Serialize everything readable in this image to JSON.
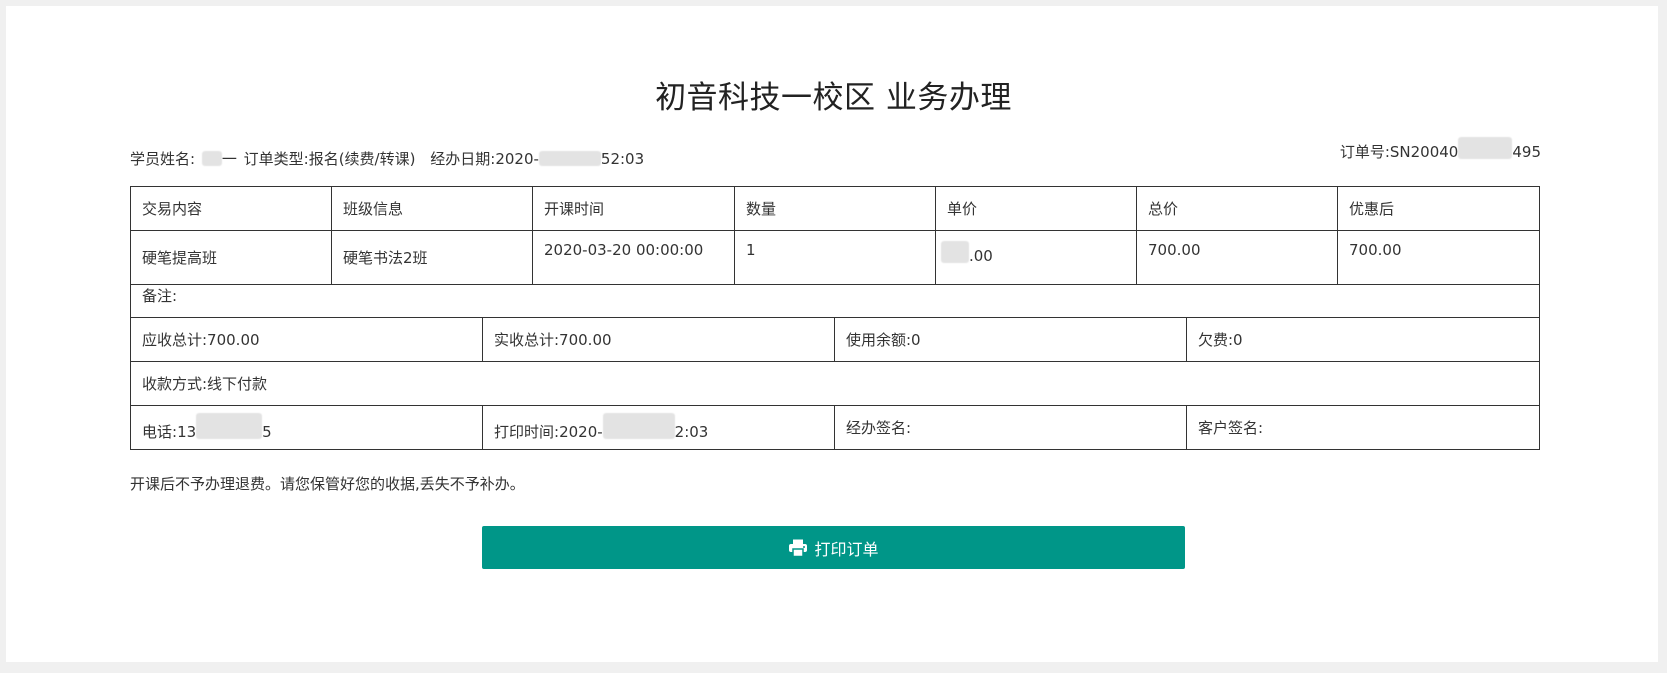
{
  "title": "初音科技一校区 业务办理",
  "meta": {
    "student_label": "学员姓名:",
    "student_suffix": "一",
    "order_type": "订单类型:报名(续费/转课)",
    "date_label": "经办日期:",
    "date_prefix": "2020-",
    "date_suffix": "52:03",
    "order_no_label": "订单号:",
    "order_no_prefix": "SN20040",
    "order_no_suffix": "495"
  },
  "table": {
    "headers": [
      "交易内容",
      "班级信息",
      "开课时间",
      "数量",
      "单价",
      "总价",
      "优惠后"
    ],
    "row": {
      "content": "硬笔提高班",
      "class_info": "硬笔书法2班",
      "start_time": "2020-03-20 00:00:00",
      "quantity": "1",
      "unit_price_suffix": ".00",
      "total": "700.00",
      "discounted": "700.00"
    },
    "remark": "备注:",
    "receivable": "应收总计:700.00",
    "received": "实收总计:700.00",
    "balance_used": "使用余额:0",
    "owed": "欠费:0",
    "payment_method": "收款方式:线下付款",
    "phone_label": "电话:",
    "phone_prefix": "13",
    "phone_suffix": "5",
    "print_time_label": "打印时间:",
    "print_time_prefix": "2020-",
    "print_time_suffix": "2:03",
    "handler_sign": "经办签名:",
    "customer_sign": "客户签名:"
  },
  "notice": "开课后不予办理退费。请您保管好您的收据,丢失不予补办。",
  "button": {
    "label": "打印订单",
    "icon": "printer-icon"
  },
  "colors": {
    "button": "#009688",
    "background": "#f0f0f0"
  }
}
